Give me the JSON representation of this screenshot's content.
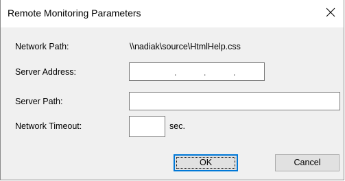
{
  "window": {
    "title": "Remote Monitoring Parameters",
    "close_icon": "close-icon"
  },
  "fields": {
    "network_path": {
      "label": "Network Path:",
      "value": "\\\\nadiak\\source\\HtmlHelp.css"
    },
    "server_address": {
      "label": "Server Address:",
      "value": ""
    },
    "server_path": {
      "label": "Server Path:",
      "value": ""
    },
    "network_timeout": {
      "label": "Network Timeout:",
      "value": "",
      "unit": "sec."
    }
  },
  "buttons": {
    "ok": "OK",
    "cancel": "Cancel"
  },
  "colors": {
    "dialog_bg": "#f0f0f0",
    "titlebar_bg": "#ffffff",
    "default_button_border": "#0078d7"
  }
}
